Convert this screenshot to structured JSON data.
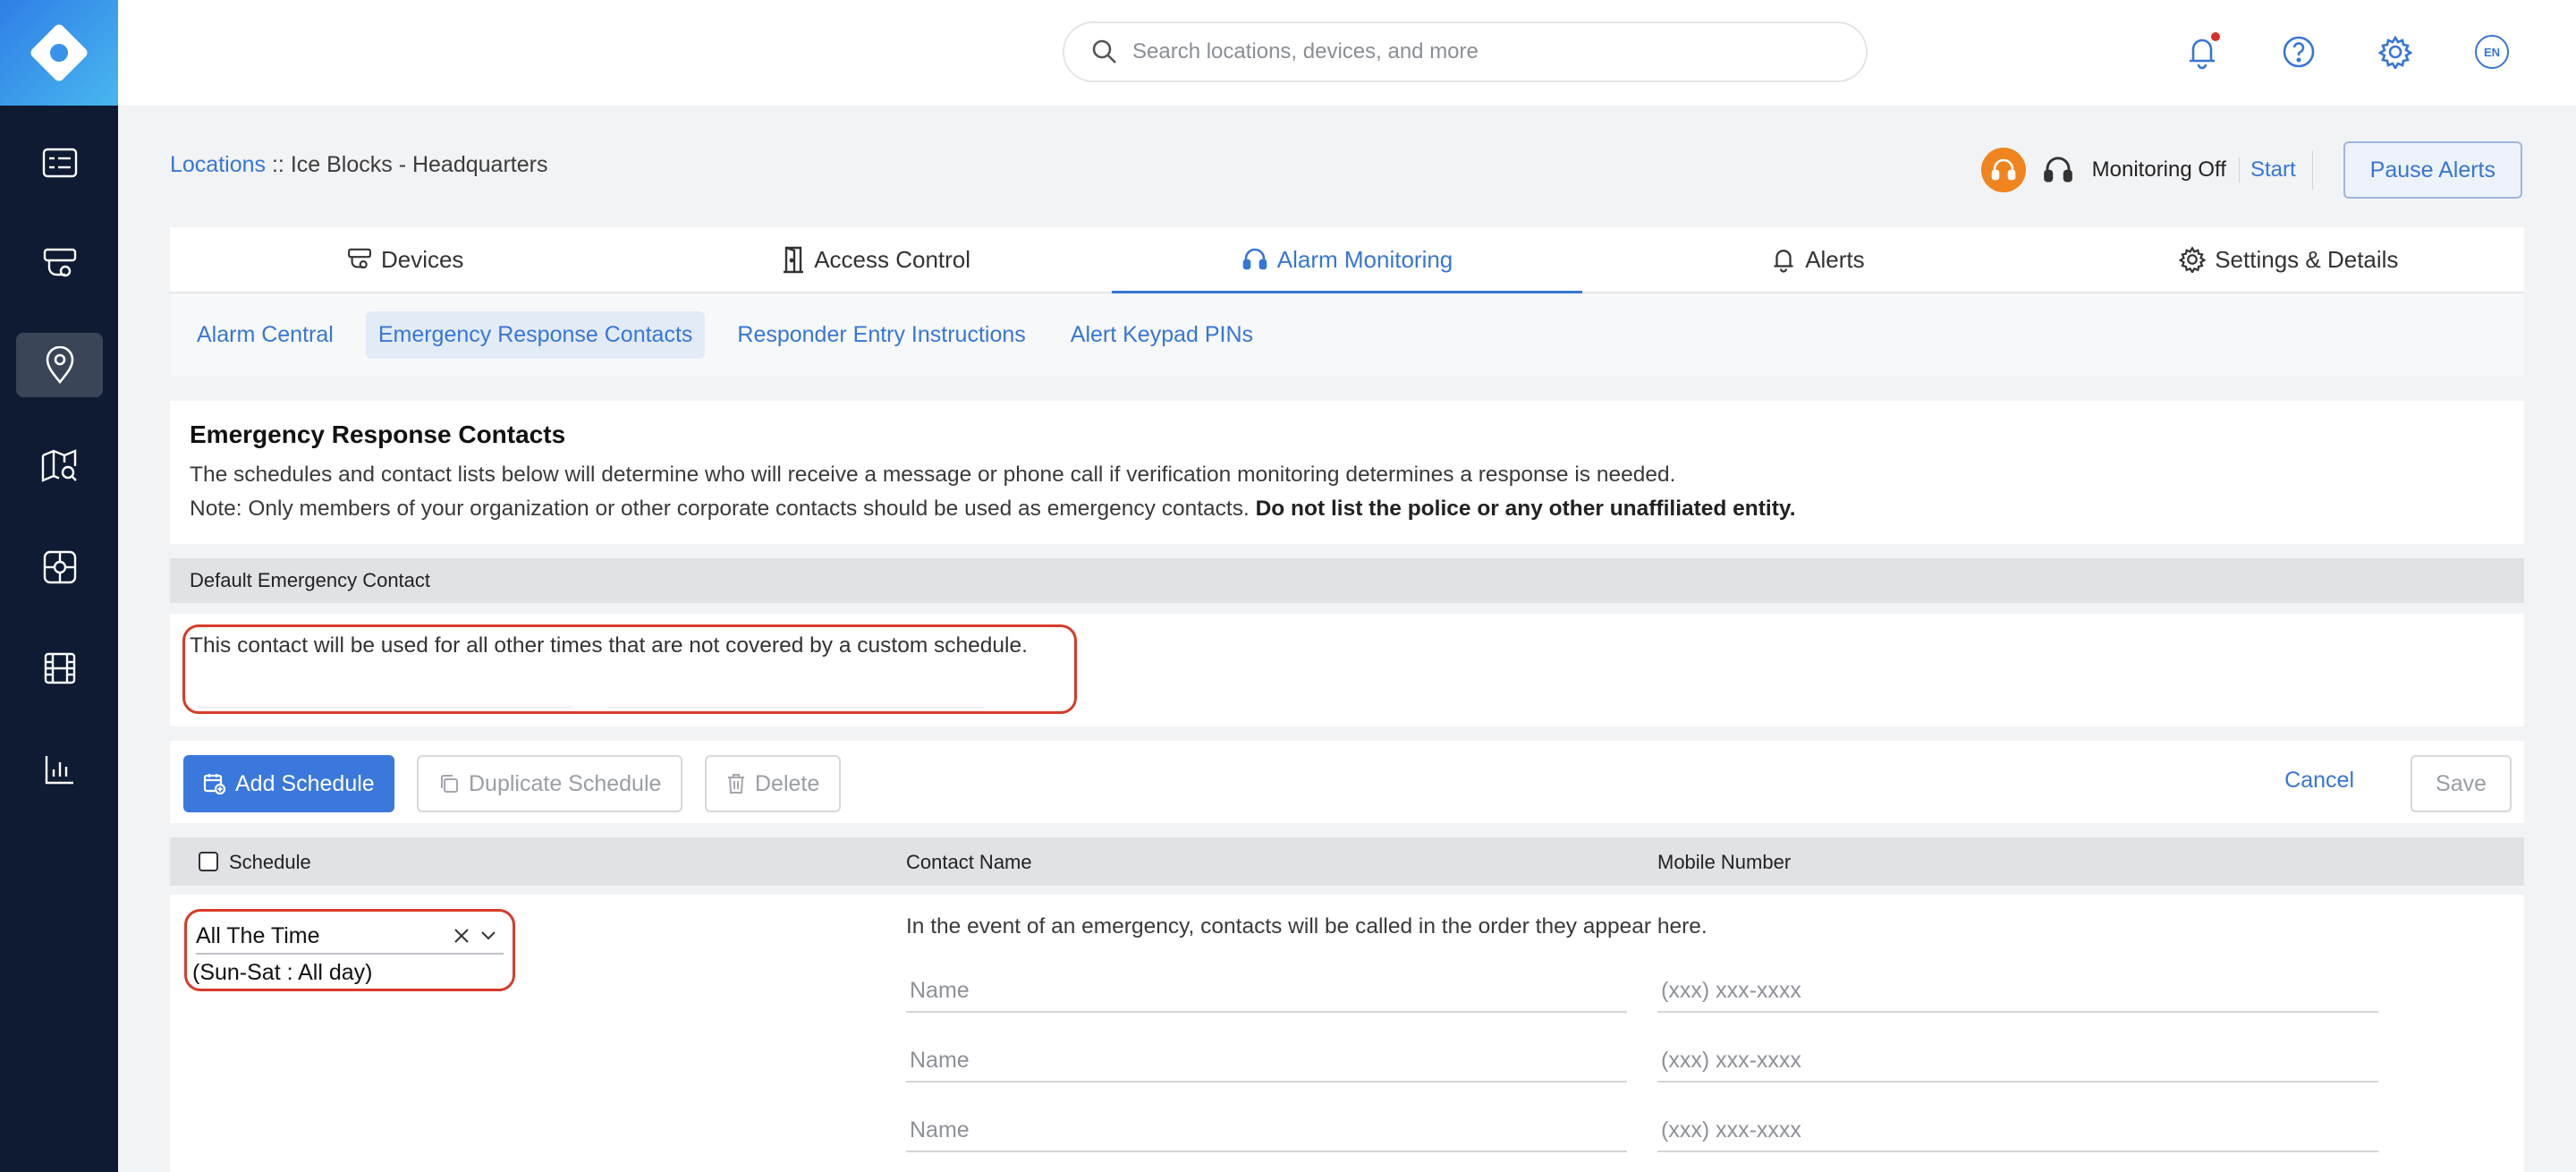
{
  "search": {
    "placeholder": "Search locations, devices, and more"
  },
  "header": {
    "language": "EN"
  },
  "sidebar": {
    "items": [
      {
        "icon": "dashboard-icon"
      },
      {
        "icon": "camera-icon"
      },
      {
        "icon": "location-pin-icon",
        "active": true
      },
      {
        "icon": "map-search-icon"
      },
      {
        "icon": "access-icon"
      },
      {
        "icon": "film-icon"
      },
      {
        "icon": "analytics-icon"
      }
    ]
  },
  "breadcrumb": {
    "root": "Locations",
    "separator": " :: ",
    "current": "Ice Blocks - Headquarters"
  },
  "monitoring": {
    "status": "Monitoring Off",
    "start_label": "Start",
    "pause_label": "Pause Alerts"
  },
  "tabs": [
    {
      "label": "Devices",
      "icon": "camera-icon"
    },
    {
      "label": "Access Control",
      "icon": "door-icon"
    },
    {
      "label": "Alarm Monitoring",
      "icon": "headset-icon",
      "active": true
    },
    {
      "label": "Alerts",
      "icon": "bell-icon"
    },
    {
      "label": "Settings & Details",
      "icon": "gear-icon"
    }
  ],
  "subtabs": [
    {
      "label": "Alarm Central"
    },
    {
      "label": "Emergency Response Contacts",
      "active": true
    },
    {
      "label": "Responder Entry Instructions"
    },
    {
      "label": "Alert Keypad PINs"
    }
  ],
  "info": {
    "title": "Emergency Response Contacts",
    "line1": "The schedules and contact lists below will determine who will receive a message or phone call if verification monitoring determines a response is needed.",
    "line2_prefix": "Note: Only members of your organization or other corporate contacts should be used as emergency contacts. ",
    "line2_bold": "Do not list the police or any other unaffiliated entity."
  },
  "default_contact": {
    "header": "Default Emergency Contact",
    "text": "This contact will be used for all other times that are not covered by a custom schedule."
  },
  "actions": {
    "add": "Add Schedule",
    "duplicate": "Duplicate Schedule",
    "delete": "Delete",
    "cancel": "Cancel",
    "save": "Save"
  },
  "table": {
    "headers": {
      "schedule": "Schedule",
      "contact": "Contact Name",
      "mobile": "Mobile Number"
    },
    "rows": [
      {
        "schedule": "All The Time",
        "schedule_detail": "(Sun-Sat : All day)",
        "note": "In the event of an emergency, contacts will be called in the order they appear here.",
        "contacts": [
          {
            "name_placeholder": "Name",
            "phone_placeholder": "(xxx) xxx-xxxx"
          },
          {
            "name_placeholder": "Name",
            "phone_placeholder": "(xxx) xxx-xxxx"
          },
          {
            "name_placeholder": "Name",
            "phone_placeholder": "(xxx) xxx-xxxx"
          }
        ]
      }
    ]
  },
  "colors": {
    "accent": "#3776d6",
    "sidebar": "#0f1b33",
    "highlight": "#d83b2a",
    "monitor_badge": "#f0851f"
  }
}
